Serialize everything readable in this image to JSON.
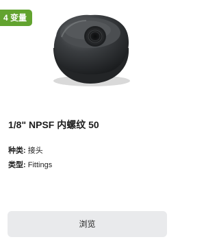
{
  "badge": {
    "label": "4 变量",
    "color": "#62a32f"
  },
  "product": {
    "title": "1/8\" NPSF 内螺纹 50",
    "image": "threaded-knob-nut-image",
    "attributes": [
      {
        "key": "种类:",
        "value": "接头"
      },
      {
        "key": "类型:",
        "value": "Fittings"
      }
    ]
  },
  "actions": {
    "browse_label": "浏览"
  }
}
